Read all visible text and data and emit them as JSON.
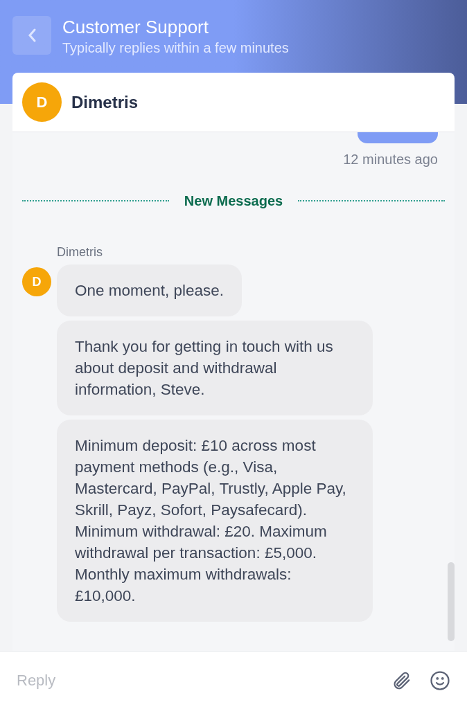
{
  "header": {
    "title": "Customer Support",
    "subtitle": "Typically replies within a few minutes"
  },
  "agent": {
    "initial": "D",
    "name": "Dimetris"
  },
  "previous": {
    "time": "12 minutes ago"
  },
  "divider": {
    "label": "New Messages"
  },
  "group": {
    "sender": "Dimetris",
    "initial": "D",
    "messages": [
      {
        "text": "One moment, please."
      },
      {
        "text": "Thank you for getting in touch with us about deposit and withdrawal information, Steve."
      },
      {
        "text": "Minimum deposit: £10 across most payment methods (e.g., Visa, Mastercard, PayPal, Trustly, Apple Pay, Skrill, Payz, Sofort, Paysafecard). Minimum withdrawal: £20. Maximum withdrawal per transaction: £5,000. Monthly maximum withdrawals: £10,000."
      }
    ]
  },
  "composer": {
    "placeholder": "Reply"
  }
}
